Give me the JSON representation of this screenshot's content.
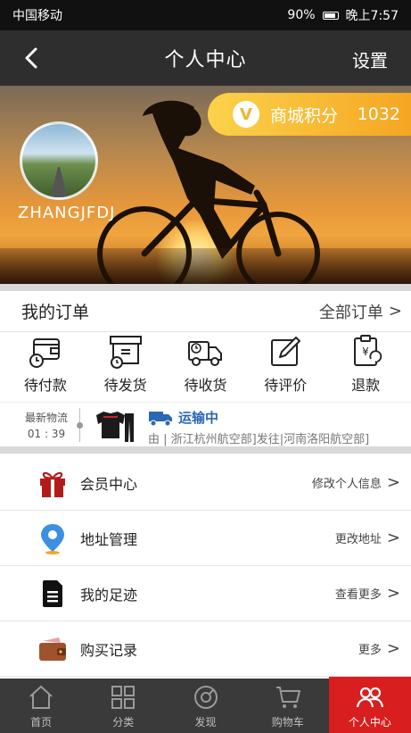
{
  "statusbar": {
    "carrier": "中国移动",
    "battery": "90%",
    "time": "晚上7:57"
  },
  "nav": {
    "title": "个人中心",
    "settings": "设置"
  },
  "profile": {
    "username": "ZHANGJFDJ",
    "points_label": "商城积分",
    "points_value": "1032",
    "points_badge": "V"
  },
  "orders": {
    "title": "我的订单",
    "all_label": "全部订单",
    "items": [
      {
        "label": "待付款",
        "icon": "wallet-clock-icon"
      },
      {
        "label": "待发货",
        "icon": "box-clock-icon"
      },
      {
        "label": "待收货",
        "icon": "truck-icon"
      },
      {
        "label": "待评价",
        "icon": "edit-icon"
      },
      {
        "label": "退款",
        "icon": "refund-clipboard-icon"
      }
    ]
  },
  "logistics": {
    "label": "最新物流",
    "time": "01 : 39",
    "status": "运输中",
    "description": "由 | 浙江杭州航空部]发往|河南洛阳航空部]"
  },
  "menu": [
    {
      "label": "会员中心",
      "action": "修改个人信息",
      "icon": "gift-icon"
    },
    {
      "label": "地址管理",
      "action": "更改地址",
      "icon": "location-pin-icon"
    },
    {
      "label": "我的足迹",
      "action": "查看更多",
      "icon": "document-icon"
    },
    {
      "label": "购买记录",
      "action": "更多",
      "icon": "wallet-icon"
    }
  ],
  "tabbar": [
    {
      "label": "首页",
      "icon": "home-icon"
    },
    {
      "label": "分类",
      "icon": "grid-icon"
    },
    {
      "label": "发现",
      "icon": "compass-icon"
    },
    {
      "label": "购物车",
      "icon": "cart-icon"
    },
    {
      "label": "个人中心",
      "icon": "user-group-icon",
      "active": true
    }
  ],
  "colors": {
    "accent": "#d81e1e",
    "points": "#f5a623",
    "nav": "#2e2e2e",
    "logistics": "#2b67b3"
  }
}
